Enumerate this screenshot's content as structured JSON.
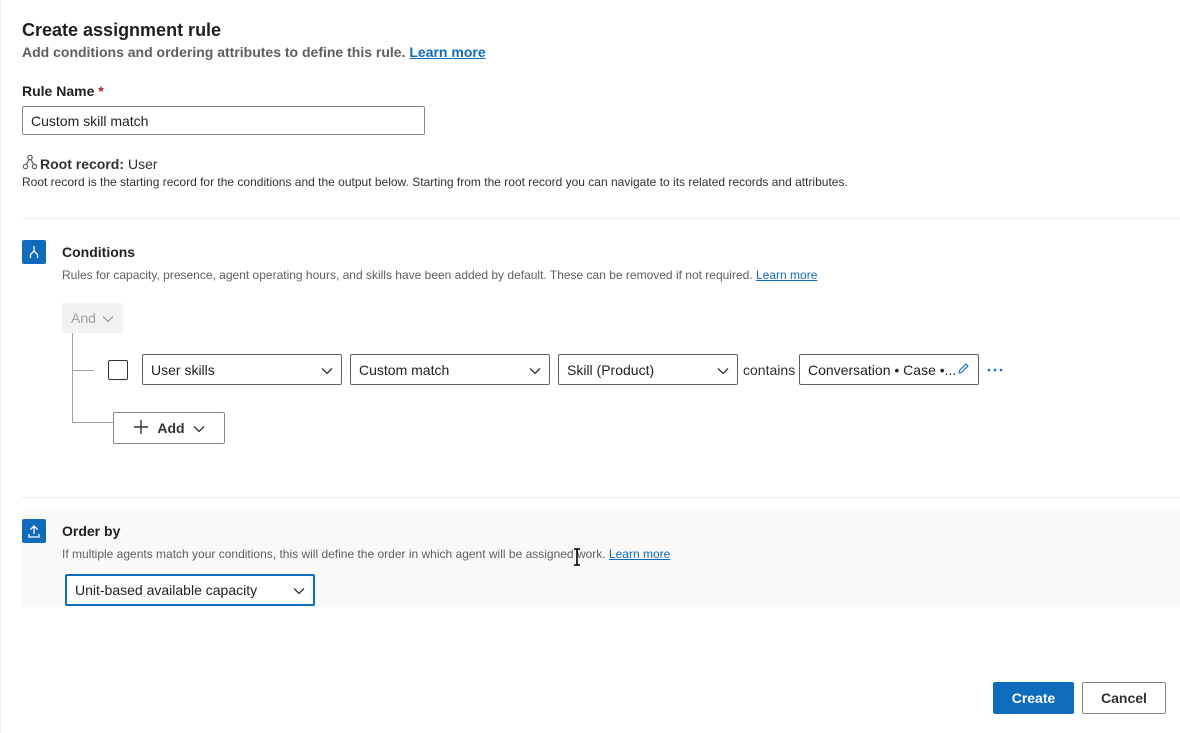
{
  "header": {
    "title": "Create assignment rule",
    "subtitle": "Add conditions and ordering attributes to define this rule.",
    "learn_more": "Learn more"
  },
  "rule_name": {
    "label": "Rule Name",
    "required_mark": "*",
    "value": "Custom skill match"
  },
  "root_record": {
    "label": "Root record:",
    "value": "User",
    "description": "Root record is the starting record for the conditions and the output below. Starting from the root record you can navigate to its related records and attributes."
  },
  "conditions": {
    "title": "Conditions",
    "description": "Rules for capacity, presence, agent operating hours, and skills have been added by default. These can be removed if not required.",
    "learn_more": "Learn more",
    "and_label": "And",
    "row": {
      "field": "User skills",
      "operator_type": "Custom match",
      "attribute": "Skill (Product)",
      "operator": "contains",
      "value": "Conversation • Case •..."
    },
    "add_label": "Add"
  },
  "order_by": {
    "title": "Order by",
    "description": "If multiple agents match your conditions, this will define the order in which agent will be assigned work.",
    "learn_more": "Learn more",
    "selected": "Unit-based available capacity"
  },
  "footer": {
    "create": "Create",
    "cancel": "Cancel"
  },
  "colors": {
    "accent": "#0f6cbd",
    "required": "#a4262c"
  }
}
